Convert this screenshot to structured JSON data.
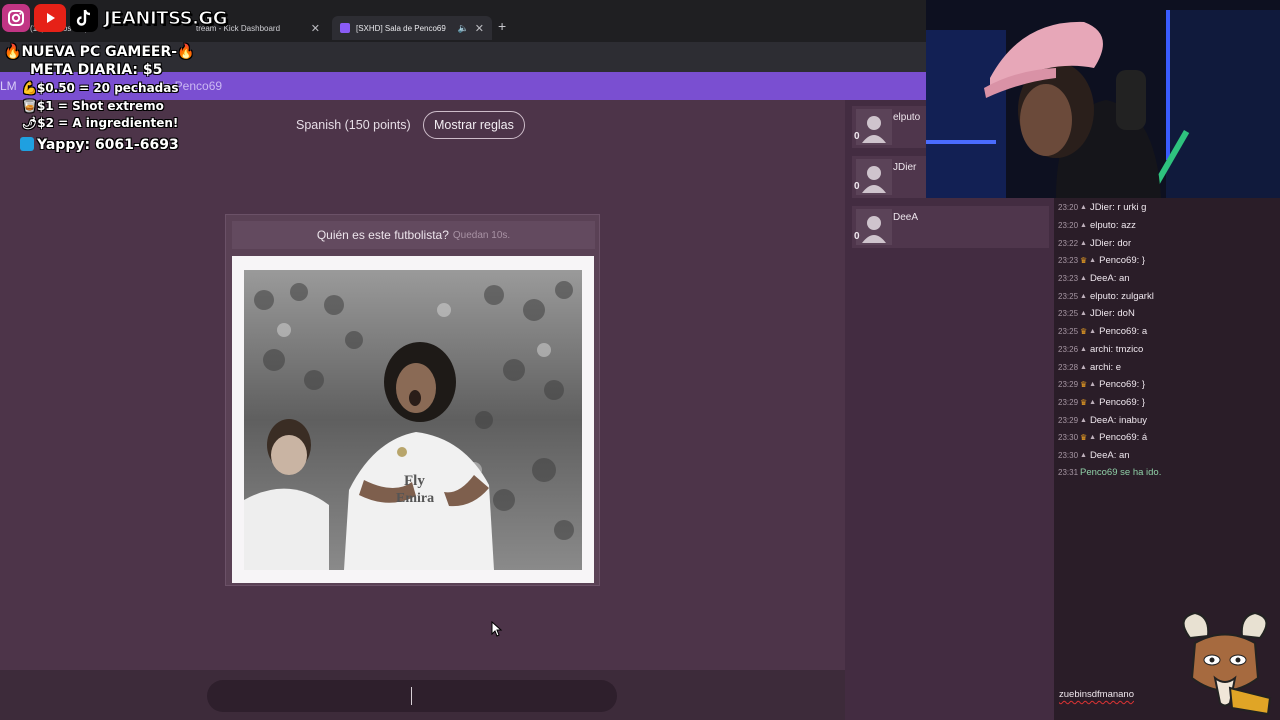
{
  "browser": {
    "tabs": [
      {
        "title": "(19) Somos la que",
        "active": false
      },
      {
        "title": "tream - Kick Dashboard",
        "active": false
      },
      {
        "title": "[SXHD] Sala de Penco69",
        "active": true
      }
    ],
    "new_tab": "+",
    "room_crumb_prefix": "LM",
    "room_crumb": "de Penco69"
  },
  "overlay": {
    "handle": "JEANITSS.GG",
    "lines": [
      "NUEVA PC GAMEER-",
      "META DIARIA: $5",
      "$0.50 = 20 pechadas",
      "$1 = Shot extremo",
      "$2 = A ingredienten!",
      "Yappy: 6061-6693"
    ]
  },
  "game": {
    "language_label": "Spanish (150 points)",
    "rules_button": "Mostrar reglas",
    "question": "Quién es este futbolista?",
    "time_left": "Quedan 10s.",
    "answer_placeholder": ""
  },
  "players": [
    {
      "name": "elputo",
      "score": "0"
    },
    {
      "name": "JDier",
      "score": "0"
    },
    {
      "name": "DeeA",
      "score": "0"
    }
  ],
  "chat": {
    "messages": [
      {
        "time": "23:20",
        "crown": false,
        "text": "JDier: r urki g"
      },
      {
        "time": "23:20",
        "crown": false,
        "text": "elputo: azz"
      },
      {
        "time": "23:22",
        "crown": false,
        "text": "JDier: dor"
      },
      {
        "time": "23:23",
        "crown": true,
        "text": "Penco69: }"
      },
      {
        "time": "23:23",
        "crown": false,
        "text": "DeeA: an"
      },
      {
        "time": "23:25",
        "crown": false,
        "text": "elputo: zulgarkl"
      },
      {
        "time": "23:25",
        "crown": false,
        "text": "JDier: doN"
      },
      {
        "time": "23:25",
        "crown": true,
        "text": "Penco69: a"
      },
      {
        "time": "23:26",
        "crown": false,
        "text": "archi: tmzico"
      },
      {
        "time": "23:28",
        "crown": false,
        "text": "archi: e"
      },
      {
        "time": "23:29",
        "crown": true,
        "text": "Penco69: }"
      },
      {
        "time": "23:29",
        "crown": true,
        "text": "Penco69: }"
      },
      {
        "time": "23:29",
        "crown": false,
        "text": "DeeA: inabuy"
      },
      {
        "time": "23:30",
        "crown": true,
        "text": "Penco69: á"
      },
      {
        "time": "23:30",
        "crown": false,
        "text": "DeeA: an"
      }
    ],
    "system": {
      "time": "23:31",
      "text": "Penco69 se ha ido."
    },
    "input_value": "zuebinsdfmanano"
  },
  "icons": {
    "instagram": "instagram-icon",
    "youtube": "youtube-icon",
    "tiktok": "tiktok-icon",
    "crown": "crown-icon",
    "user": "user-icon",
    "cursor": "cursor-icon",
    "mascot": "goat-mascot-icon"
  },
  "colors": {
    "purple_bar": "#7a4fd1",
    "page_bg": "#4d3449",
    "chat_bg": "#2a1d28",
    "system_msg": "#8fd0a7"
  }
}
